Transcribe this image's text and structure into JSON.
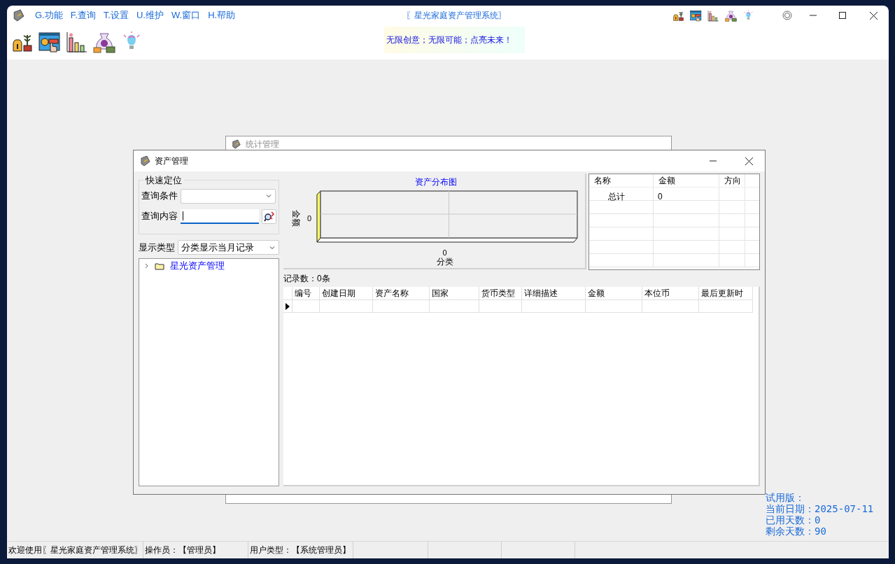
{
  "app": {
    "title": "〖星光家庭资产管理系统〗",
    "menu": [
      "G.功能",
      "F.查询",
      "T.设置",
      "U.维护",
      "W.窗口",
      "H.帮助"
    ],
    "slogan": "无限创意；无限可能；点亮未来！"
  },
  "background_window": {
    "title": "统计管理"
  },
  "window": {
    "title": "资产管理",
    "quick_locate": {
      "title": "快速定位",
      "condition_label": "查询条件",
      "content_label": "查询内容"
    },
    "display_type": {
      "label": "显示类型",
      "value": "分类显示当月记录"
    },
    "tree": [
      {
        "label": "星光资产管理",
        "expanded": false
      }
    ],
    "chart": {
      "title": "资产分布图",
      "y_tick": "0",
      "y_label": "金额",
      "x_tick": "0",
      "x_label": "分类"
    },
    "summary": {
      "columns": [
        "名称",
        "金额",
        "方向"
      ],
      "rows": [
        {
          "name": "总计",
          "amount": "0"
        }
      ]
    },
    "record_count": "记录数：0条",
    "grid": {
      "columns": [
        "编号",
        "创建日期",
        "资产名称",
        "国家",
        "货币类型",
        "详细描述",
        "金额",
        "本位币",
        "最后更新时"
      ]
    }
  },
  "trial": [
    "试用版：",
    "当前日期：2025-07-11",
    "已用天数：0",
    "剩余天数：90"
  ],
  "status_bar": [
    "欢迎使用〖星光家庭资产管理系统〗",
    "操作员：【管理员】",
    "用户类型：【系统管理员】"
  ]
}
